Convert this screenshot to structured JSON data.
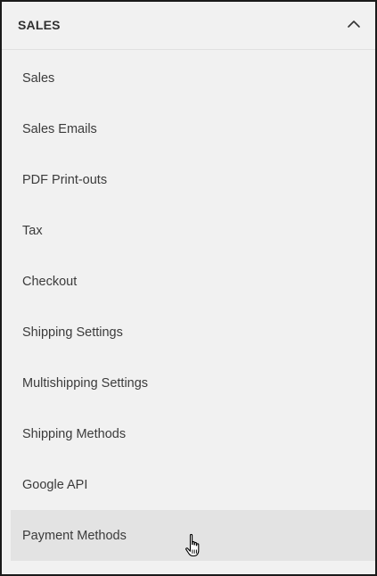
{
  "section": {
    "title": "SALES",
    "expanded": true,
    "toggle_icon": "chevron-up-icon"
  },
  "menu": {
    "items": [
      {
        "label": "Sales"
      },
      {
        "label": "Sales Emails"
      },
      {
        "label": "PDF Print-outs"
      },
      {
        "label": "Tax"
      },
      {
        "label": "Checkout"
      },
      {
        "label": "Shipping Settings"
      },
      {
        "label": "Multishipping Settings"
      },
      {
        "label": "Shipping Methods"
      },
      {
        "label": "Google API"
      },
      {
        "label": "Payment Methods",
        "hovered": true
      }
    ]
  },
  "cursor": {
    "icon": "hand-pointer-icon"
  },
  "colors": {
    "panel_background": "#f1f1f1",
    "hover_background": "#e3e3e3",
    "text": "#3b3b3b",
    "border": "#1a1a1a"
  }
}
